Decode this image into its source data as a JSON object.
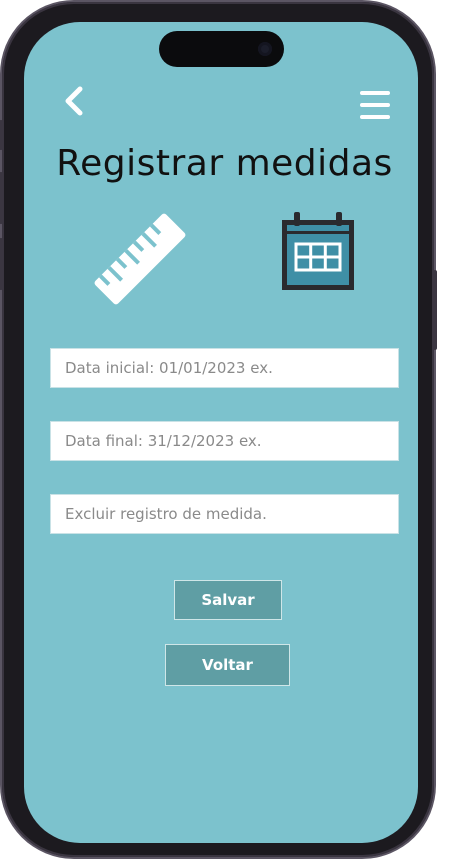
{
  "header": {
    "back_icon": "chevron-left-icon",
    "menu_icon": "hamburger-menu-icon",
    "title": "Registrar medidas"
  },
  "icons": {
    "ruler": "ruler-icon",
    "calendar": "calendar-icon"
  },
  "form": {
    "start_date_placeholder": "Data inicial: 01/01/2023 ex.",
    "end_date_placeholder": "Data final: 31/12/2023 ex.",
    "delete_placeholder": "Excluir registro de medida."
  },
  "actions": {
    "save_label": "Salvar",
    "back_label": "Voltar"
  },
  "colors": {
    "screen_background": "#7cc2cd",
    "button_background": "#5f9ea4",
    "calendar_fill": "#3f8fa6"
  }
}
